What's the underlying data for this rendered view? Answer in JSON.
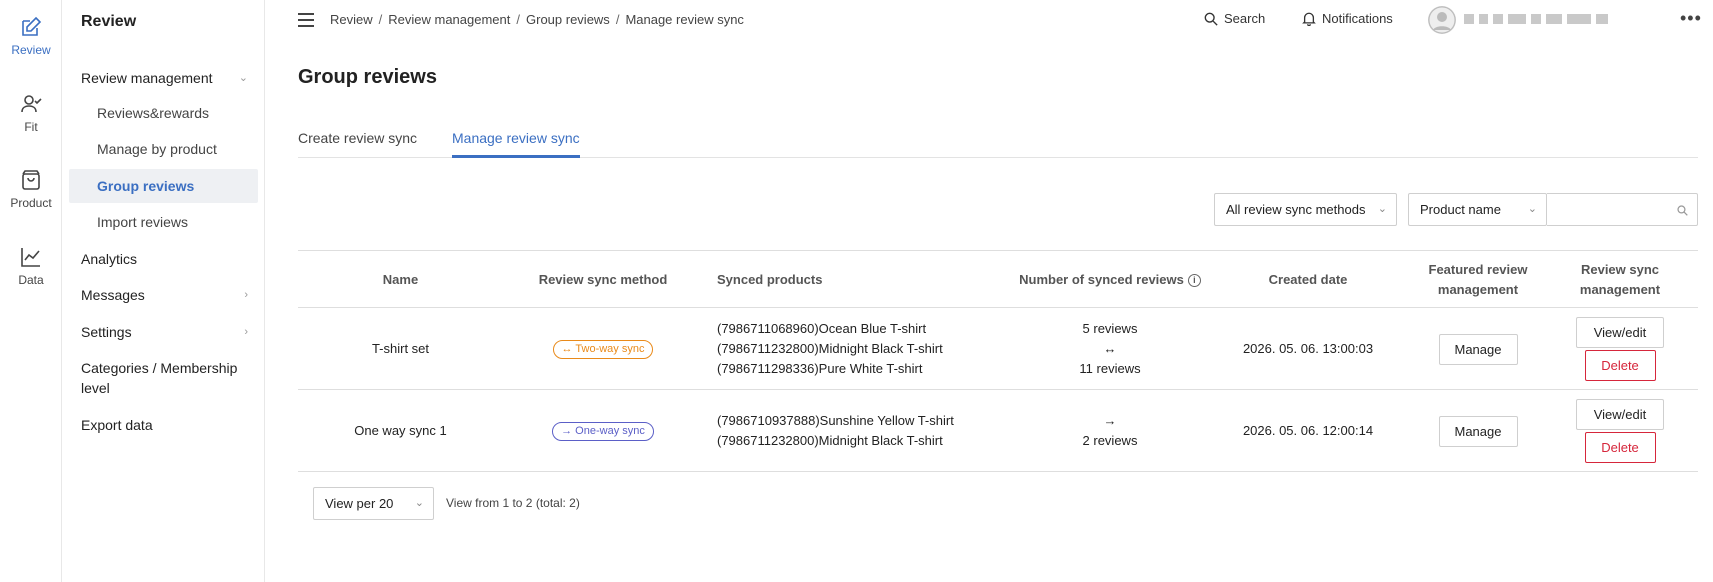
{
  "rail": [
    {
      "label": "Review",
      "icon": "edit-icon",
      "active": true
    },
    {
      "label": "Fit",
      "icon": "user-check-icon"
    },
    {
      "label": "Product",
      "icon": "bag-icon"
    },
    {
      "label": "Data",
      "icon": "line-chart-icon"
    }
  ],
  "sidebar": {
    "title": "Review",
    "items": [
      {
        "label": "Review management",
        "chevron": "down"
      },
      {
        "label": "Reviews&rewards"
      },
      {
        "label": "Manage by product"
      },
      {
        "label": "Group reviews",
        "active": true
      },
      {
        "label": "Import reviews"
      },
      {
        "label": "Analytics"
      },
      {
        "label": "Messages",
        "chevron": "right"
      },
      {
        "label": "Settings",
        "chevron": "right"
      },
      {
        "label": "Categories / Membership level"
      },
      {
        "label": "Export data"
      }
    ]
  },
  "header": {
    "breadcrumb": [
      "Review",
      "Review management",
      "Group reviews",
      "Manage review sync"
    ],
    "search_label": "Search",
    "notifications_label": "Notifications"
  },
  "main": {
    "title": "Group reviews",
    "tabs": [
      {
        "label": "Create review sync"
      },
      {
        "label": "Manage review sync",
        "active": true
      }
    ],
    "filters": {
      "method_select": "All review sync methods",
      "field_select": "Product name",
      "search_value": ""
    },
    "table": {
      "headers": {
        "name": "Name",
        "method": "Review sync method",
        "products": "Synced products",
        "count": "Number of synced reviews",
        "created": "Created date",
        "featured_line1": "Featured review",
        "featured_line2": "management",
        "sync_line1": "Review sync",
        "sync_line2": "management"
      },
      "rows": [
        {
          "name": "T-shirt set",
          "method": "↔ Two-way sync",
          "products": [
            "(7986711068960)Ocean Blue T-shirt",
            "(7986711232800)Midnight Black T-shirt",
            "(7986711298336)Pure White T-shirt"
          ],
          "count_top": "5 reviews",
          "count_arrow": "↔",
          "count_bottom": "11 reviews",
          "created": "2026. 05. 06. 13:00:03",
          "manage": "Manage",
          "view": "View/edit",
          "delete": "Delete"
        },
        {
          "name": "One way sync 1",
          "method": "→ One-way sync",
          "products": [
            "(7986710937888)Sunshine Yellow T-shirt",
            "(7986711232800)Midnight Black T-shirt"
          ],
          "count_arrow": "→",
          "count_bottom": "2 reviews",
          "created": "2026. 05. 06. 12:00:14",
          "manage": "Manage",
          "view": "View/edit",
          "delete": "Delete"
        }
      ]
    },
    "pagination": {
      "per_page": "View per 20",
      "info": "View from 1 to 2 (total: 2)"
    }
  },
  "colors": {
    "accent": "#3b6fc2",
    "two_way": "#e98a1a",
    "one_way": "#5b5fc7",
    "danger": "#d6263b"
  }
}
